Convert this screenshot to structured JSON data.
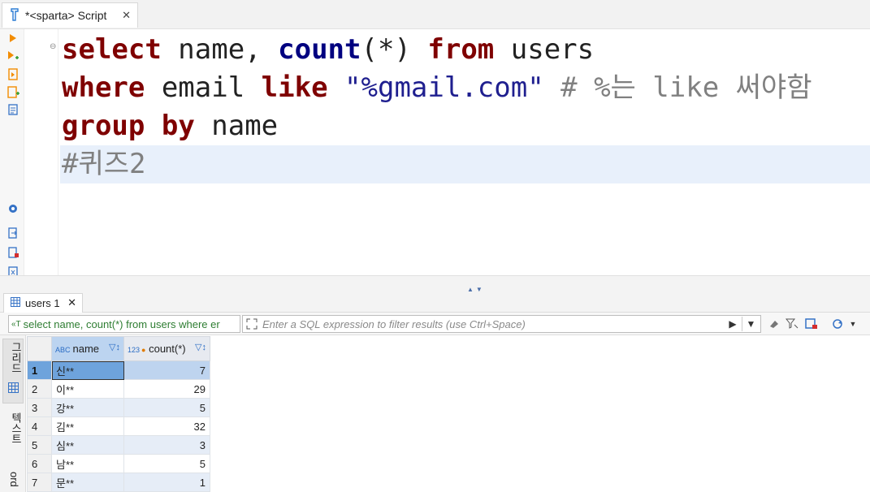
{
  "tab": {
    "title": "*<sparta> Script",
    "close": "✕"
  },
  "editor": {
    "lines": [
      {
        "kw1": "select",
        "sp1": " name, ",
        "fn": "count",
        "p": "(*)",
        "sp2": " ",
        "kw2": "from",
        "rest": " users"
      },
      {
        "kw1": "where",
        "mid": " email ",
        "kw2": "like",
        "sp": " ",
        "str": "\"%gmail.com\"",
        "cmt": " # %는 like 써야함"
      },
      {
        "kw1": "group",
        "sp": " ",
        "kw2": "by",
        "rest": " name"
      },
      {
        "cmt": "#퀴즈2"
      }
    ]
  },
  "results_tab": {
    "label": "users 1",
    "close": "✕"
  },
  "filter": {
    "query": "select name, count(*) from users where er",
    "placeholder": "Enter a SQL expression to filter results (use Ctrl+Space)"
  },
  "sidebar": {
    "grid_label": "그리드",
    "text_label": "텍스트",
    "record_label": "ord"
  },
  "grid": {
    "headers": {
      "name_type": "ABC",
      "name": "name",
      "count_type": "123",
      "count": "count(*)"
    },
    "rows": [
      {
        "n": "1",
        "name": "신**",
        "count": "7"
      },
      {
        "n": "2",
        "name": "이**",
        "count": "29"
      },
      {
        "n": "3",
        "name": "강**",
        "count": "5"
      },
      {
        "n": "4",
        "name": "김**",
        "count": "32"
      },
      {
        "n": "5",
        "name": "심**",
        "count": "3"
      },
      {
        "n": "6",
        "name": "남**",
        "count": "5"
      },
      {
        "n": "7",
        "name": "문**",
        "count": "1"
      }
    ]
  }
}
